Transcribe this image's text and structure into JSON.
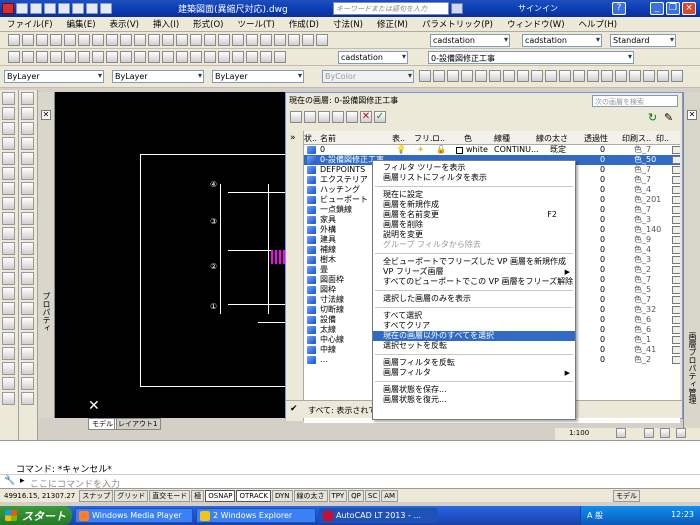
{
  "titlebar": {
    "title": "建築図面(異縮尺対応).dwg",
    "search_placeholder": "キーワードまたは語句を入力",
    "signin": "サインイン",
    "help": "?"
  },
  "menubar": [
    "ファイル(F)",
    "編集(E)",
    "表示(V)",
    "挿入(I)",
    "形式(O)",
    "ツール(T)",
    "作成(D)",
    "寸法(N)",
    "修正(M)",
    "パラメトリック(P)",
    "ウィンドウ(W)",
    "ヘルプ(H)"
  ],
  "toolbars": {
    "dimstyle": "cadstation",
    "textstyle": "cadstation",
    "tablestyle": "cadstation",
    "standard": "Standard",
    "layer_combo": "0-設備図修正工事",
    "color": "ByLayer",
    "linetype": "ByLayer",
    "lineweight": "ByLayer",
    "plotstyle": "ByColor",
    "annot_style": "cadstation"
  },
  "canvas": {
    "side_label": "プロパティ",
    "tabs": [
      "モデル",
      "レイアウト1"
    ],
    "marks": [
      "④",
      "③",
      "②",
      "①"
    ]
  },
  "layer_panel": {
    "title": "現在の画層: 0-設備図修正工事",
    "search_placeholder": "次の画層を検索",
    "columns": [
      "状..",
      "名前",
      "表..",
      "フリ..",
      "ロ..",
      "色",
      "線種",
      "線の太さ",
      "透過性",
      "印刷ス..",
      "印.."
    ],
    "side_label": "画層プロパティ管理",
    "bottom_text": "すべて: 表示されて",
    "first_row": {
      "name": "0",
      "color": "white",
      "linetype": "CONTINU...",
      "lineweight": "既定",
      "transparency": "0",
      "plotstyle": "色_7"
    },
    "rows": [
      {
        "name": "0-設備図修正工事",
        "num": "0",
        "pst": "色_50",
        "selected": true
      },
      {
        "name": "DEFPOINTS",
        "num": "0",
        "pst": "色_7"
      },
      {
        "name": "エクステリア",
        "num": "0",
        "pst": "色_7"
      },
      {
        "name": "ハッチング",
        "num": "0",
        "pst": "色_4"
      },
      {
        "name": "ビューポート",
        "num": "0",
        "pst": "色_201"
      },
      {
        "name": "一点鎖線",
        "num": "0",
        "pst": "色_7"
      },
      {
        "name": "家具",
        "num": "0",
        "pst": "色_3"
      },
      {
        "name": "外構",
        "num": "0",
        "pst": "色_140"
      },
      {
        "name": "建具",
        "num": "0",
        "pst": "色_9"
      },
      {
        "name": "補線",
        "num": "0",
        "pst": "色_4"
      },
      {
        "name": "樹木",
        "num": "0",
        "pst": "色_3"
      },
      {
        "name": "畳",
        "num": "0",
        "pst": "色_2"
      },
      {
        "name": "図面枠",
        "num": "0",
        "pst": "色_7"
      },
      {
        "name": "図枠",
        "num": "0",
        "pst": "色_5"
      },
      {
        "name": "寸法線",
        "num": "0",
        "pst": "色_7"
      },
      {
        "name": "切断線",
        "num": "0",
        "pst": "色_32"
      },
      {
        "name": "設備",
        "num": "0",
        "pst": "色_6"
      },
      {
        "name": "太線",
        "num": "0",
        "pst": "色_6"
      },
      {
        "name": "中心線",
        "num": "0",
        "pst": "色_1"
      },
      {
        "name": "中線",
        "num": "0",
        "pst": "色_41"
      },
      {
        "name": "…",
        "num": "0",
        "pst": "色_2"
      }
    ]
  },
  "context_menu": [
    {
      "label": "フィルタ ツリーを表示"
    },
    {
      "label": "画層リストにフィルタを表示"
    },
    {
      "sep": true
    },
    {
      "label": "現在に設定"
    },
    {
      "label": "画層を新規作成"
    },
    {
      "label": "画層を名前変更",
      "shortcut": "F2"
    },
    {
      "label": "画層を削除"
    },
    {
      "label": "説明を変更"
    },
    {
      "label": "グループ フィルタから除去",
      "disabled": true
    },
    {
      "sep": true
    },
    {
      "label": "全ビューポートでフリーズした VP 画層を新規作成"
    },
    {
      "label": "VP フリーズ画層",
      "arrow": true
    },
    {
      "label": "すべてのビューポートでこの VP 画層をフリーズ解除"
    },
    {
      "sep": true
    },
    {
      "label": "選択した画層のみを表示"
    },
    {
      "sep": true
    },
    {
      "label": "すべて選択"
    },
    {
      "label": "すべてクリア"
    },
    {
      "label": "現在の画層以外のすべてを選択",
      "highlight": true
    },
    {
      "label": "選択セットを反転"
    },
    {
      "sep": true
    },
    {
      "label": "画層フィルタを反転"
    },
    {
      "label": "画層フィルタ",
      "arrow": true
    },
    {
      "sep": true
    },
    {
      "label": "画層状態を保存..."
    },
    {
      "label": "画層状態を復元..."
    }
  ],
  "viewport_scale": "1:100",
  "command": {
    "history": "コマンド:  *キャンセル*",
    "placeholder": "ここにコマンドを入力"
  },
  "statusbar": {
    "coords": "49916.15, 21307.27",
    "buttons": [
      "スナップ",
      "グリッド",
      "直交モード",
      "極",
      "OSNAP",
      "OTRACK",
      "DYN",
      "線の太さ",
      "TPY",
      "QP",
      "SC",
      "AM"
    ],
    "on_buttons": [
      "OSNAP",
      "OTRACK"
    ],
    "model": "モデル"
  },
  "taskbar": {
    "start": "スタート",
    "tasks": [
      "Windows Media Player",
      "2 Windows Explorer",
      "AutoCAD LT 2013 - ..."
    ],
    "time": "12:23",
    "ime": "A 般"
  }
}
